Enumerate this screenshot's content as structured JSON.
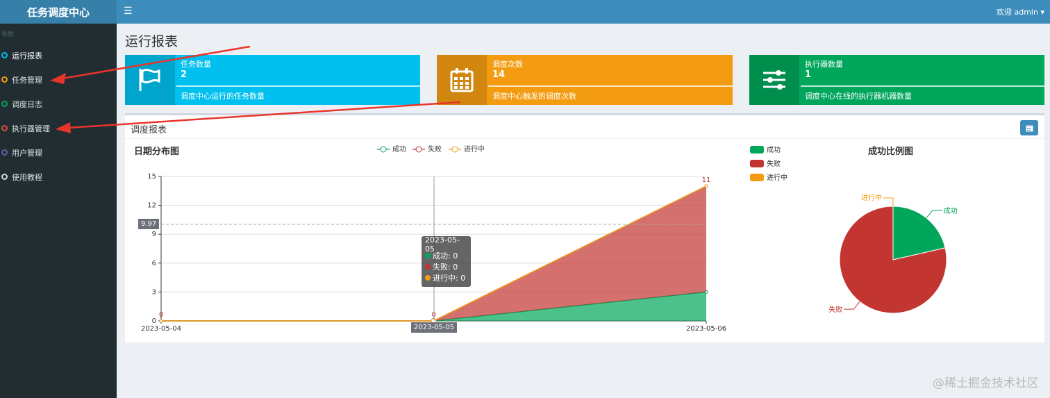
{
  "app": {
    "title": "任务调度中心"
  },
  "header": {
    "user_label": "欢迎 admin"
  },
  "sidebar": {
    "header": "导航",
    "items": [
      {
        "label": "运行报表",
        "color": "#00c0ef"
      },
      {
        "label": "任务管理",
        "color": "#f39c12"
      },
      {
        "label": "调度日志",
        "color": "#00a65a"
      },
      {
        "label": "执行器管理",
        "color": "#dd4b39"
      },
      {
        "label": "用户管理",
        "color": "#605ca8"
      },
      {
        "label": "使用教程",
        "color": "#d2d6de"
      }
    ]
  },
  "page": {
    "title": "运行报表"
  },
  "info_boxes": [
    {
      "label": "任务数量",
      "value": "2",
      "desc": "调度中心运行的任务数量",
      "color": "#00c0ef",
      "icon": "flag-icon"
    },
    {
      "label": "调度次数",
      "value": "14",
      "desc": "调度中心触发的调度次数",
      "color": "#f39c12",
      "icon": "calendar-icon"
    },
    {
      "label": "执行器数量",
      "value": "1",
      "desc": "调度中心在线的执行器机器数量",
      "color": "#00a65a",
      "icon": "sliders-icon"
    }
  ],
  "report": {
    "title": "调度报表",
    "line_chart_title": "日期分布图",
    "pie_chart_title": "成功比例图",
    "tooltip": {
      "date": "2023-05-05",
      "rows": [
        "成功: 0",
        "失败: 0",
        "进行中: 0"
      ]
    },
    "pointer_y_label": "9.97",
    "pointer_x_label": "2023-05-05"
  },
  "chart_data": [
    {
      "type": "area",
      "title": "日期分布图",
      "x": [
        "2023-05-04",
        "2023-05-05",
        "2023-05-06"
      ],
      "ylim": [
        0,
        15
      ],
      "yticks": [
        0,
        3,
        6,
        9,
        12,
        15
      ],
      "stacked": true,
      "series": [
        {
          "name": "成功",
          "values": [
            0,
            0,
            3
          ],
          "color": "#00a65a"
        },
        {
          "name": "失败",
          "values": [
            0,
            0,
            11
          ],
          "color": "#c23531"
        },
        {
          "name": "进行中",
          "values": [
            0,
            0,
            0
          ],
          "color": "#f39c12"
        }
      ],
      "point_labels": [
        "0",
        "0",
        "11"
      ],
      "legend": "top"
    },
    {
      "type": "pie",
      "title": "成功比例图",
      "slices": [
        {
          "name": "成功",
          "value": 3,
          "color": "#00a65a"
        },
        {
          "name": "失败",
          "value": 11,
          "color": "#c23531"
        },
        {
          "name": "进行中",
          "value": 0,
          "color": "#f39c12"
        }
      ],
      "legend": "top-left"
    }
  ],
  "watermark": "@稀土掘金技术社区"
}
